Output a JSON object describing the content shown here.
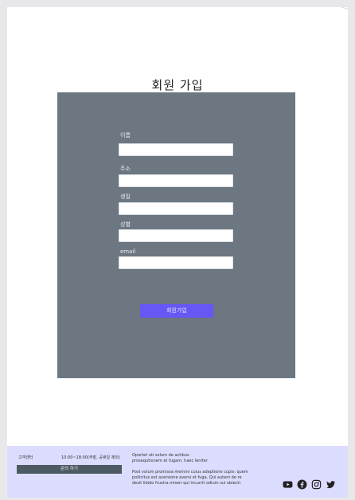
{
  "page": {
    "title": "회원 가입"
  },
  "form": {
    "fields": [
      {
        "label": "이름",
        "value": ""
      },
      {
        "label": "주소",
        "value": ""
      },
      {
        "label": "생일",
        "value": ""
      },
      {
        "label": "성별",
        "value": ""
      },
      {
        "label": "email",
        "value": ""
      }
    ],
    "submit_label": "회원가입"
  },
  "footer": {
    "support_label": "고객센터",
    "hours": "10:00~18:00(주말, 공휴일 제외)",
    "inquiry_button": "문의 하기",
    "desc_1_line_1": "Oportet uti solum de actibus",
    "desc_1_line_2": "prosequtionem et fugam, haec leniter",
    "desc_2_line_1": "Post volum promissa memini cuius adeptione cupis: quem",
    "desc_2_line_2": "pollicitus est aversione aversi et fuga. Qui autem de re",
    "desc_2_line_3": "desit libido frustra miseri qui incurrit odium sui obiecti.",
    "social_icons": [
      "youtube-icon",
      "facebook-icon",
      "instagram-icon",
      "twitter-icon"
    ]
  },
  "colors": {
    "panel": "#6c7782",
    "accent": "#6558f5",
    "footer_bg": "#dcdcff",
    "inquiry_button": "#4d5a64"
  }
}
